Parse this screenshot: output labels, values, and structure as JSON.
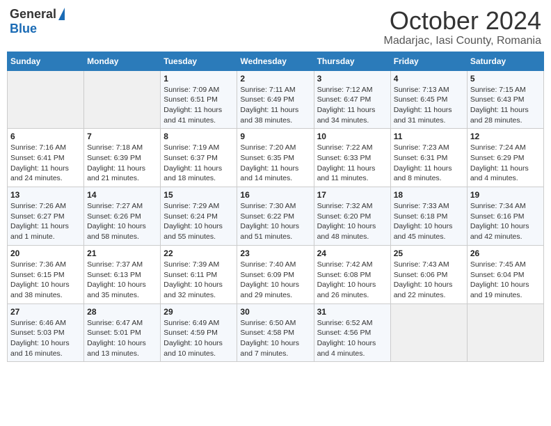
{
  "header": {
    "logo_general": "General",
    "logo_blue": "Blue",
    "title": "October 2024",
    "subtitle": "Madarjac, Iasi County, Romania"
  },
  "days_of_week": [
    "Sunday",
    "Monday",
    "Tuesday",
    "Wednesday",
    "Thursday",
    "Friday",
    "Saturday"
  ],
  "weeks": [
    [
      {
        "day": "",
        "sunrise": "",
        "sunset": "",
        "daylight": ""
      },
      {
        "day": "",
        "sunrise": "",
        "sunset": "",
        "daylight": ""
      },
      {
        "day": "1",
        "sunrise": "Sunrise: 7:09 AM",
        "sunset": "Sunset: 6:51 PM",
        "daylight": "Daylight: 11 hours and 41 minutes."
      },
      {
        "day": "2",
        "sunrise": "Sunrise: 7:11 AM",
        "sunset": "Sunset: 6:49 PM",
        "daylight": "Daylight: 11 hours and 38 minutes."
      },
      {
        "day": "3",
        "sunrise": "Sunrise: 7:12 AM",
        "sunset": "Sunset: 6:47 PM",
        "daylight": "Daylight: 11 hours and 34 minutes."
      },
      {
        "day": "4",
        "sunrise": "Sunrise: 7:13 AM",
        "sunset": "Sunset: 6:45 PM",
        "daylight": "Daylight: 11 hours and 31 minutes."
      },
      {
        "day": "5",
        "sunrise": "Sunrise: 7:15 AM",
        "sunset": "Sunset: 6:43 PM",
        "daylight": "Daylight: 11 hours and 28 minutes."
      }
    ],
    [
      {
        "day": "6",
        "sunrise": "Sunrise: 7:16 AM",
        "sunset": "Sunset: 6:41 PM",
        "daylight": "Daylight: 11 hours and 24 minutes."
      },
      {
        "day": "7",
        "sunrise": "Sunrise: 7:18 AM",
        "sunset": "Sunset: 6:39 PM",
        "daylight": "Daylight: 11 hours and 21 minutes."
      },
      {
        "day": "8",
        "sunrise": "Sunrise: 7:19 AM",
        "sunset": "Sunset: 6:37 PM",
        "daylight": "Daylight: 11 hours and 18 minutes."
      },
      {
        "day": "9",
        "sunrise": "Sunrise: 7:20 AM",
        "sunset": "Sunset: 6:35 PM",
        "daylight": "Daylight: 11 hours and 14 minutes."
      },
      {
        "day": "10",
        "sunrise": "Sunrise: 7:22 AM",
        "sunset": "Sunset: 6:33 PM",
        "daylight": "Daylight: 11 hours and 11 minutes."
      },
      {
        "day": "11",
        "sunrise": "Sunrise: 7:23 AM",
        "sunset": "Sunset: 6:31 PM",
        "daylight": "Daylight: 11 hours and 8 minutes."
      },
      {
        "day": "12",
        "sunrise": "Sunrise: 7:24 AM",
        "sunset": "Sunset: 6:29 PM",
        "daylight": "Daylight: 11 hours and 4 minutes."
      }
    ],
    [
      {
        "day": "13",
        "sunrise": "Sunrise: 7:26 AM",
        "sunset": "Sunset: 6:27 PM",
        "daylight": "Daylight: 11 hours and 1 minute."
      },
      {
        "day": "14",
        "sunrise": "Sunrise: 7:27 AM",
        "sunset": "Sunset: 6:26 PM",
        "daylight": "Daylight: 10 hours and 58 minutes."
      },
      {
        "day": "15",
        "sunrise": "Sunrise: 7:29 AM",
        "sunset": "Sunset: 6:24 PM",
        "daylight": "Daylight: 10 hours and 55 minutes."
      },
      {
        "day": "16",
        "sunrise": "Sunrise: 7:30 AM",
        "sunset": "Sunset: 6:22 PM",
        "daylight": "Daylight: 10 hours and 51 minutes."
      },
      {
        "day": "17",
        "sunrise": "Sunrise: 7:32 AM",
        "sunset": "Sunset: 6:20 PM",
        "daylight": "Daylight: 10 hours and 48 minutes."
      },
      {
        "day": "18",
        "sunrise": "Sunrise: 7:33 AM",
        "sunset": "Sunset: 6:18 PM",
        "daylight": "Daylight: 10 hours and 45 minutes."
      },
      {
        "day": "19",
        "sunrise": "Sunrise: 7:34 AM",
        "sunset": "Sunset: 6:16 PM",
        "daylight": "Daylight: 10 hours and 42 minutes."
      }
    ],
    [
      {
        "day": "20",
        "sunrise": "Sunrise: 7:36 AM",
        "sunset": "Sunset: 6:15 PM",
        "daylight": "Daylight: 10 hours and 38 minutes."
      },
      {
        "day": "21",
        "sunrise": "Sunrise: 7:37 AM",
        "sunset": "Sunset: 6:13 PM",
        "daylight": "Daylight: 10 hours and 35 minutes."
      },
      {
        "day": "22",
        "sunrise": "Sunrise: 7:39 AM",
        "sunset": "Sunset: 6:11 PM",
        "daylight": "Daylight: 10 hours and 32 minutes."
      },
      {
        "day": "23",
        "sunrise": "Sunrise: 7:40 AM",
        "sunset": "Sunset: 6:09 PM",
        "daylight": "Daylight: 10 hours and 29 minutes."
      },
      {
        "day": "24",
        "sunrise": "Sunrise: 7:42 AM",
        "sunset": "Sunset: 6:08 PM",
        "daylight": "Daylight: 10 hours and 26 minutes."
      },
      {
        "day": "25",
        "sunrise": "Sunrise: 7:43 AM",
        "sunset": "Sunset: 6:06 PM",
        "daylight": "Daylight: 10 hours and 22 minutes."
      },
      {
        "day": "26",
        "sunrise": "Sunrise: 7:45 AM",
        "sunset": "Sunset: 6:04 PM",
        "daylight": "Daylight: 10 hours and 19 minutes."
      }
    ],
    [
      {
        "day": "27",
        "sunrise": "Sunrise: 6:46 AM",
        "sunset": "Sunset: 5:03 PM",
        "daylight": "Daylight: 10 hours and 16 minutes."
      },
      {
        "day": "28",
        "sunrise": "Sunrise: 6:47 AM",
        "sunset": "Sunset: 5:01 PM",
        "daylight": "Daylight: 10 hours and 13 minutes."
      },
      {
        "day": "29",
        "sunrise": "Sunrise: 6:49 AM",
        "sunset": "Sunset: 4:59 PM",
        "daylight": "Daylight: 10 hours and 10 minutes."
      },
      {
        "day": "30",
        "sunrise": "Sunrise: 6:50 AM",
        "sunset": "Sunset: 4:58 PM",
        "daylight": "Daylight: 10 hours and 7 minutes."
      },
      {
        "day": "31",
        "sunrise": "Sunrise: 6:52 AM",
        "sunset": "Sunset: 4:56 PM",
        "daylight": "Daylight: 10 hours and 4 minutes."
      },
      {
        "day": "",
        "sunrise": "",
        "sunset": "",
        "daylight": ""
      },
      {
        "day": "",
        "sunrise": "",
        "sunset": "",
        "daylight": ""
      }
    ]
  ]
}
